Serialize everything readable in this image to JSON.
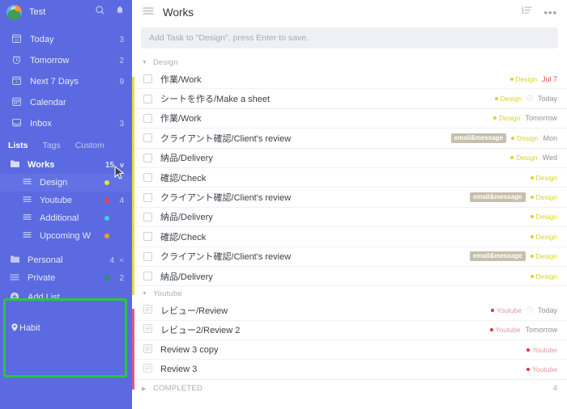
{
  "sidebar": {
    "user": "Test",
    "icons": {
      "search": "search-icon",
      "bell": "bell-icon"
    },
    "nav": [
      {
        "label": "Today",
        "count": "3",
        "icon": "calendar-today-icon"
      },
      {
        "label": "Tomorrow",
        "count": "2",
        "icon": "alarm-icon"
      },
      {
        "label": "Next 7 Days",
        "count": "9",
        "icon": "calendar-week-icon"
      },
      {
        "label": "Calendar",
        "count": "",
        "icon": "calendar-icon"
      },
      {
        "label": "Inbox",
        "count": "3",
        "icon": "inbox-icon"
      }
    ],
    "tabs": [
      {
        "label": "Lists",
        "active": true
      },
      {
        "label": "Tags",
        "active": false
      },
      {
        "label": "Custom",
        "active": false
      }
    ],
    "lists": [
      {
        "label": "Works",
        "count": "15",
        "type": "folder",
        "chevron": "v",
        "dot": "",
        "selected": false,
        "child": false,
        "highlighted": true
      },
      {
        "label": "Design",
        "count": "",
        "type": "list",
        "chevron": "",
        "dot": "#e7e03a",
        "selected": true,
        "child": true,
        "highlighted": true
      },
      {
        "label": "Youtube",
        "count": "4",
        "type": "list",
        "chevron": "",
        "dot": "#f4453e",
        "selected": false,
        "child": true,
        "highlighted": true
      },
      {
        "label": "Additional",
        "count": "",
        "type": "list",
        "chevron": "",
        "dot": "#34d6e8",
        "selected": false,
        "child": true,
        "highlighted": true
      },
      {
        "label": "Upcoming W",
        "count": "",
        "type": "list",
        "chevron": "",
        "dot": "#f79a28",
        "selected": false,
        "child": true,
        "highlighted": true
      },
      {
        "label": "Personal",
        "count": "4",
        "type": "folder",
        "chevron": "<",
        "dot": "",
        "selected": false,
        "child": false,
        "highlighted": false
      },
      {
        "label": "Private",
        "count": "2",
        "type": "list",
        "chevron": "",
        "dot": "#1e9c4d",
        "selected": false,
        "child": false,
        "highlighted": false
      }
    ],
    "add_list": "Add List",
    "habit": "Habit"
  },
  "header": {
    "title": "Works",
    "menu_icon": "hamburger-icon",
    "sort_icon": "sort-icon",
    "more_icon": "more-options-icon"
  },
  "add_task": {
    "placeholder": "Add Task to \"Design\", press Enter to save."
  },
  "groups": [
    {
      "name": "Design",
      "strip_color": "#e7e03a",
      "expanded": true,
      "count": "",
      "tasks": [
        {
          "title": "作業/Work",
          "icon": "checkbox",
          "tag": "",
          "list": "Design",
          "list_color": "#d8d335",
          "date": "Jul 7",
          "date_color": "#e0514a",
          "reminder": false
        },
        {
          "title": "シートを作る/Make a sheet",
          "icon": "checkbox",
          "tag": "",
          "list": "Design",
          "list_color": "#d8d335",
          "date": "Today",
          "date_color": "#9aa0ab",
          "reminder": true
        },
        {
          "title": "作業/Work",
          "icon": "checkbox",
          "tag": "",
          "list": "Design",
          "list_color": "#d8d335",
          "date": "Tomorrow",
          "date_color": "#9aa0ab",
          "reminder": false
        },
        {
          "title": "クライアント確認/Client's review",
          "icon": "checkbox",
          "tag": "email&message",
          "list": "Design",
          "list_color": "#d8d335",
          "date": "Mon",
          "date_color": "#9aa0ab",
          "reminder": false
        },
        {
          "title": "納品/Delivery",
          "icon": "checkbox",
          "tag": "",
          "list": "Design",
          "list_color": "#d8d335",
          "date": "Wed",
          "date_color": "#9aa0ab",
          "reminder": false
        },
        {
          "title": "確認/Check",
          "icon": "checkbox",
          "tag": "",
          "list": "Design",
          "list_color": "#d8d335",
          "date": "",
          "date_color": "#9aa0ab",
          "reminder": false
        },
        {
          "title": "クライアント確認/Client's review",
          "icon": "checkbox",
          "tag": "email&message",
          "list": "Design",
          "list_color": "#d8d335",
          "date": "",
          "date_color": "#9aa0ab",
          "reminder": false
        },
        {
          "title": "納品/Delivery",
          "icon": "checkbox",
          "tag": "",
          "list": "Design",
          "list_color": "#d8d335",
          "date": "",
          "date_color": "#9aa0ab",
          "reminder": false
        },
        {
          "title": "確認/Check",
          "icon": "checkbox",
          "tag": "",
          "list": "Design",
          "list_color": "#d8d335",
          "date": "",
          "date_color": "#9aa0ab",
          "reminder": false
        },
        {
          "title": "クライアント確認/Client's review",
          "icon": "checkbox",
          "tag": "email&message",
          "list": "Design",
          "list_color": "#d8d335",
          "date": "",
          "date_color": "#9aa0ab",
          "reminder": false
        },
        {
          "title": "納品/Delivery",
          "icon": "checkbox",
          "tag": "",
          "list": "Design",
          "list_color": "#d8d335",
          "date": "",
          "date_color": "#9aa0ab",
          "reminder": false
        }
      ]
    },
    {
      "name": "Youtube",
      "strip_color": "#e05a7a",
      "expanded": true,
      "count": "",
      "tasks": [
        {
          "title": "レビュー/Review",
          "icon": "note",
          "tag": "",
          "list": "Youtube",
          "list_color": "#e0303a",
          "date": "Today",
          "date_color": "#9aa0ab",
          "reminder": true
        },
        {
          "title": "レビュー2/Review 2",
          "icon": "note",
          "tag": "",
          "list": "Youtube",
          "list_color": "#e0303a",
          "date": "Tomorrow",
          "date_color": "#9aa0ab",
          "reminder": false
        },
        {
          "title": "Review 3 copy",
          "icon": "note",
          "tag": "",
          "list": "Youtube",
          "list_color": "#e0303a",
          "date": "",
          "date_color": "#9aa0ab",
          "reminder": false
        },
        {
          "title": "Review 3",
          "icon": "note",
          "tag": "",
          "list": "Youtube",
          "list_color": "#e0303a",
          "date": "",
          "date_color": "#9aa0ab",
          "reminder": false
        }
      ]
    }
  ],
  "completed": {
    "label": "COMPLETED",
    "count": "4",
    "expanded": false
  },
  "colors": {
    "sidebar_bg": "#5b6ae0",
    "sidebar_selected": "#6272e4",
    "selection_box": "#2ec43f",
    "tag_pill": "#c6bfac",
    "overdue": "#e0514a"
  }
}
